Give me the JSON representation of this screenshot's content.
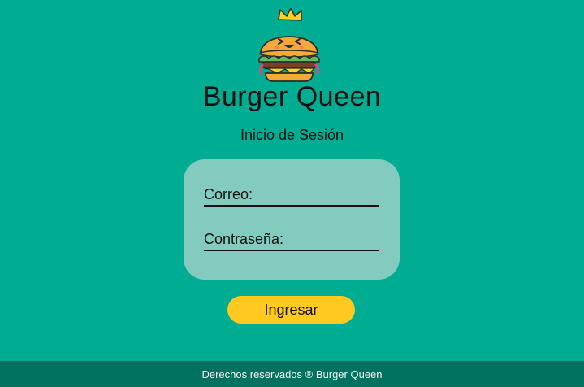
{
  "brand": {
    "title": "Burger Queen",
    "logo_icon": "crowned-burger-icon"
  },
  "login": {
    "heading": "Inicio de Sesión",
    "email_label": "Correo:",
    "email_value": "",
    "password_label": "Contraseña:",
    "password_value": "",
    "submit_label": "Ingresar"
  },
  "footer": {
    "text": "Derechos reservados ® Burger Queen"
  },
  "colors": {
    "background": "#00AC92",
    "card": "#82CBBE",
    "button": "#FFC91F",
    "footer": "#00725F"
  }
}
